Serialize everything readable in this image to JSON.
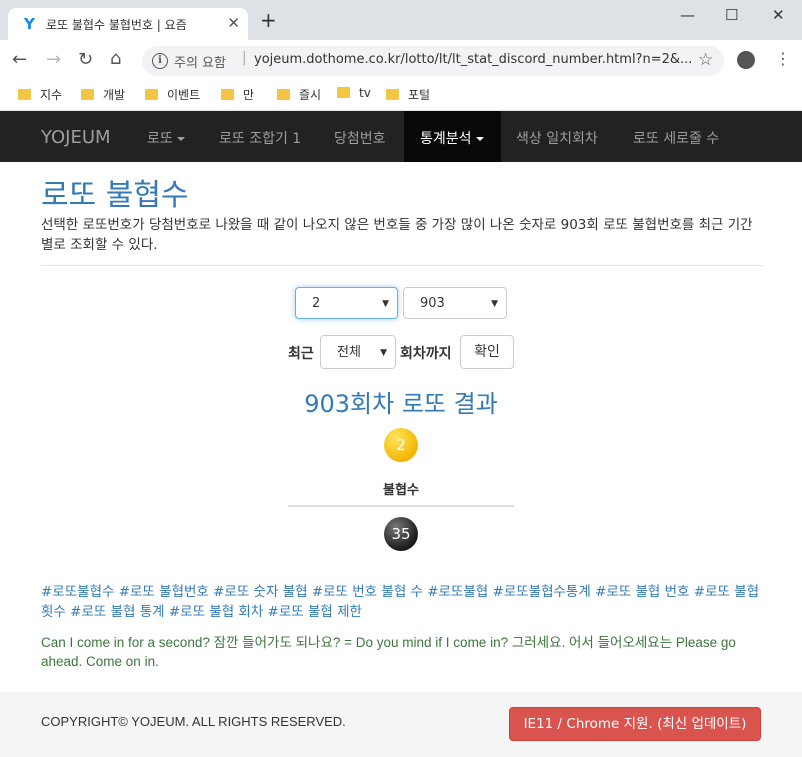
{
  "browser": {
    "tab_title": "로또 불협수 불협번호 | 요즘",
    "favicon": "Y",
    "security": "주의 요함",
    "url": "yojeum.dothome.co.kr/lotto/lt/lt_stat_discord_number.html?n=2&...",
    "bookmarks": [
      "지수",
      "개발",
      "이벤트",
      "만",
      "즐시",
      "tv",
      "포털"
    ]
  },
  "nav": {
    "brand": "YOJEUM",
    "items": [
      "로또",
      "로또 조합기 1",
      "당첨번호",
      "통계분석",
      "색상 일치회차",
      "로또 세로줄 수"
    ],
    "active_index": 3
  },
  "page": {
    "title": "로또 불협수",
    "description": "선택한 로또번호가 당첨번호로 나왔을 때 같이 나오지 않은 번호들 중 가장 많이 나온 숫자로 903회 로또 불협번호를 최근 기간별로 조회할 수 있다."
  },
  "form": {
    "number_select": "2",
    "round_select": "903",
    "recent_label": "최근",
    "period_select": "전체",
    "until_label": "회차까지",
    "confirm_label": "확인"
  },
  "result": {
    "title": "903회차 로또 결과",
    "selected_ball": "2",
    "nonmatch_label": "불협수",
    "nonmatch_ball": "35"
  },
  "tags": "#로또불협수 #로또 불협번호 #로또 숫자 불협 #로또 번호 불협 수 #로또불협 #로또불협수통계 #로또 불협 번호 #로또 불협 횟수 #로또 불협 통계 #로또 불협 회차 #로또 불협 제한",
  "english": "Can I come in for a second? 잠깐 들어가도 되나요? = Do you mind if I come in? 그러세요. 어서 들어오세요는 Please go ahead. Come on in.",
  "footer": {
    "copyright": "COPYRIGHT© YOJEUM. ALL RIGHTS RESERVED.",
    "support_button": "IE11 / Chrome 지원. (최신 업데이트)"
  },
  "colors": {
    "link": "#337ab7",
    "navbar": "#222222",
    "ball_yellow": "#f2b705",
    "danger": "#d9534f"
  }
}
